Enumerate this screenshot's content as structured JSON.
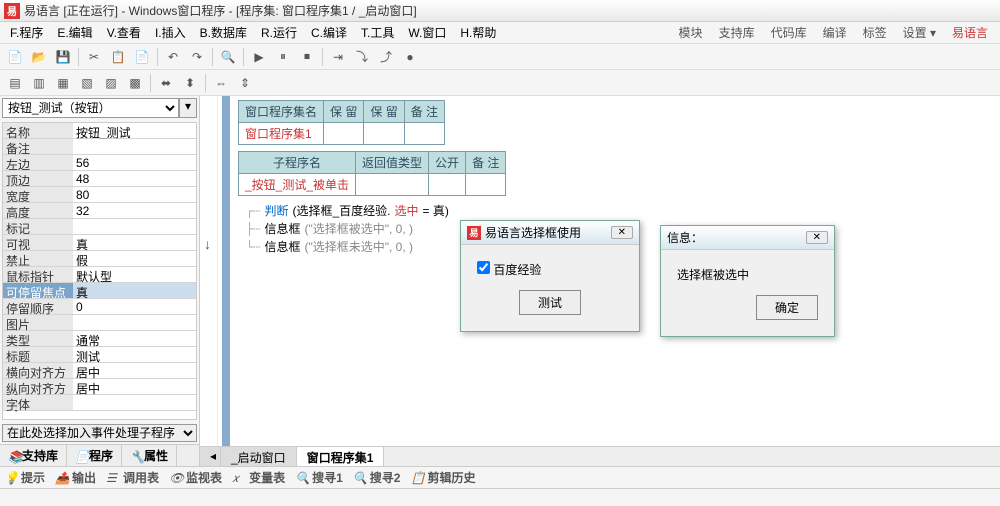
{
  "title": "易语言 [正在运行] - Windows窗口程序 - [程序集: 窗口程序集1 / _启动窗口]",
  "menus": [
    "F.程序",
    "E.编辑",
    "V.查看",
    "I.插入",
    "B.数据库",
    "R.运行",
    "C.编译",
    "T.工具",
    "W.窗口",
    "H.帮助"
  ],
  "menusRight": [
    "模块",
    "支持库",
    "代码库",
    "编译",
    "标签",
    "设置 ▾"
  ],
  "elink": "易语言",
  "combo": "按钮_测试（按钮）",
  "props": [
    {
      "k": "名称",
      "v": "按钮_测试"
    },
    {
      "k": "备注",
      "v": ""
    },
    {
      "k": "左边",
      "v": "56"
    },
    {
      "k": "顶边",
      "v": "48"
    },
    {
      "k": "宽度",
      "v": "80"
    },
    {
      "k": "高度",
      "v": "32"
    },
    {
      "k": "标记",
      "v": ""
    },
    {
      "k": "可视",
      "v": "真"
    },
    {
      "k": "禁止",
      "v": "假"
    },
    {
      "k": "鼠标指针",
      "v": "默认型"
    },
    {
      "k": "可停留焦点",
      "v": "真",
      "sel": true
    },
    {
      "k": "停留顺序",
      "v": "0"
    },
    {
      "k": "图片",
      "v": ""
    },
    {
      "k": "类型",
      "v": "通常"
    },
    {
      "k": "标题",
      "v": "测试"
    },
    {
      "k": "横向对齐方式",
      "v": "居中"
    },
    {
      "k": "纵向对齐方式",
      "v": "居中"
    },
    {
      "k": "字体",
      "v": ""
    }
  ],
  "bottomCombo": "在此处选择加入事件处理子程序",
  "leftTabs": [
    "支持库",
    "程序",
    "属性"
  ],
  "table1": {
    "headers": [
      "窗口程序集名",
      "保 留",
      "保 留",
      "备 注"
    ],
    "row": "窗口程序集1"
  },
  "table2": {
    "headers": [
      "子程序名",
      "返回值类型",
      "公开",
      "备 注"
    ],
    "row": "_按钮_测试_被单击"
  },
  "code": {
    "line1": {
      "kw": "判断",
      "txt": "(选择框_百度经验.",
      "sel": "选中",
      "eq": " = 真)"
    },
    "line2": {
      "fn": "信息框",
      "args": "(\"选择框被选中\", 0, )"
    },
    "line3": {
      "fn": "信息框",
      "args": "(\"选择框未选中\", 0, )"
    }
  },
  "docTabs": [
    "_启动窗口",
    "窗口程序集1"
  ],
  "dialog1": {
    "title": "易语言选择框使用",
    "checkbox": "百度经验",
    "btn": "测试"
  },
  "dialog2": {
    "title": "信息：",
    "msg": "选择框被选中",
    "btn": "确定"
  },
  "bottomTabs": [
    "提示",
    "输出",
    "调用表",
    "监视表",
    "变量表",
    "搜寻1",
    "搜寻2",
    "剪辑历史"
  ]
}
